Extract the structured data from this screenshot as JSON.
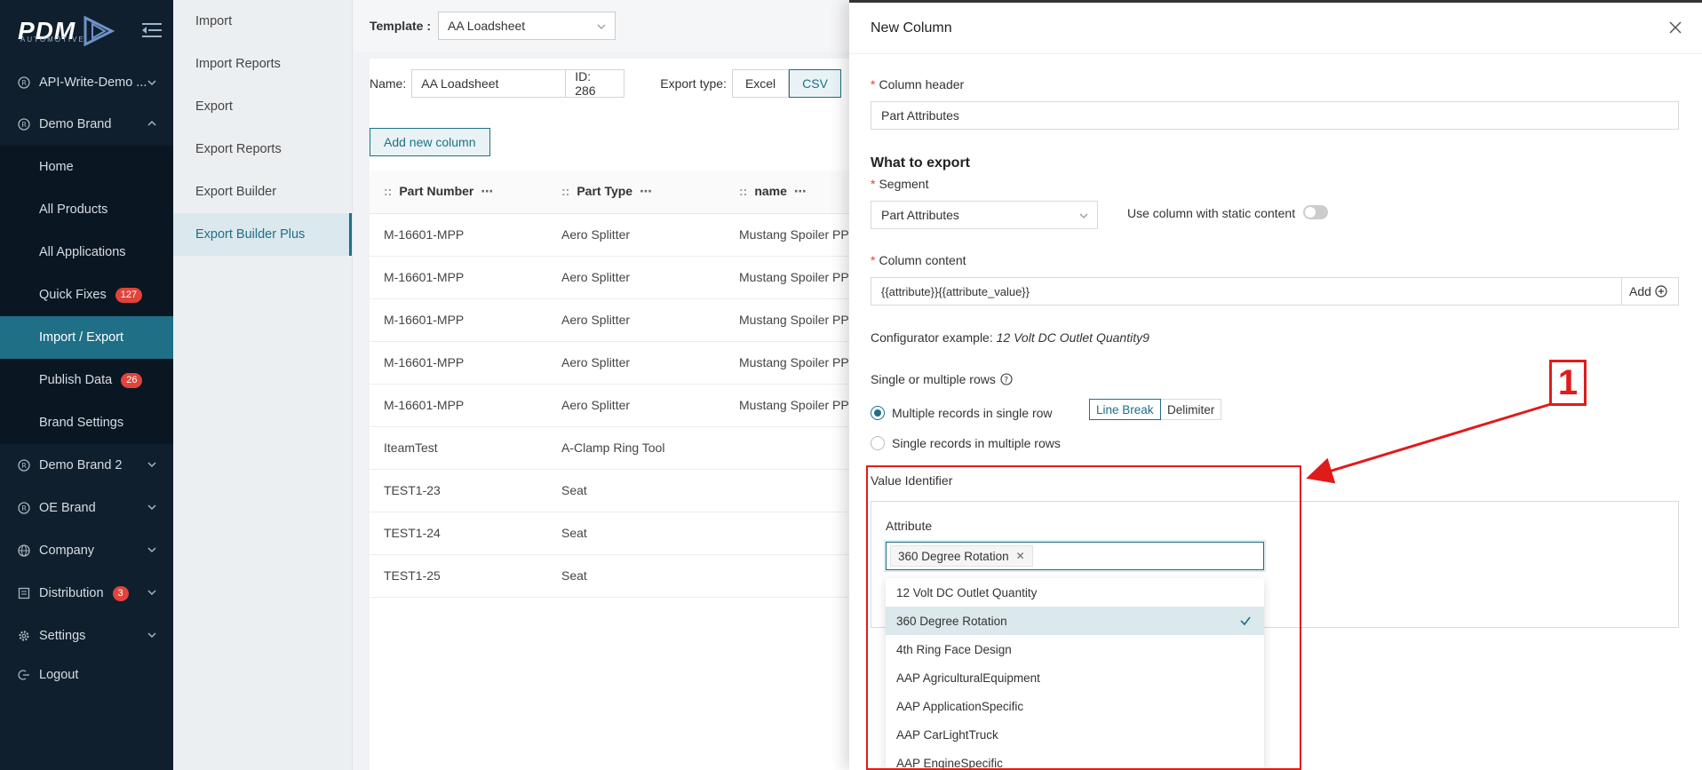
{
  "brand": {
    "logo_text": "PDM",
    "logo_sub": "AUTOMOTIVE"
  },
  "sidebar": {
    "items": [
      {
        "label": "API-Write-Demo ...",
        "icon": "registered-icon"
      },
      {
        "label": "Demo Brand",
        "icon": "registered-icon"
      },
      {
        "label": "Home"
      },
      {
        "label": "All Products"
      },
      {
        "label": "All Applications"
      },
      {
        "label": "Quick Fixes",
        "badge": "127"
      },
      {
        "label": "Import / Export"
      },
      {
        "label": "Publish Data",
        "badge": "26"
      },
      {
        "label": "Brand Settings"
      },
      {
        "label": "Demo Brand 2",
        "icon": "registered-icon"
      },
      {
        "label": "OE Brand",
        "icon": "registered-icon"
      },
      {
        "label": "Company",
        "icon": "globe-icon"
      },
      {
        "label": "Distribution",
        "icon": "distribution-icon",
        "badge": "3"
      },
      {
        "label": "Settings",
        "icon": "gear-icon"
      },
      {
        "label": "Logout",
        "icon": "logout-icon"
      }
    ]
  },
  "submenu": {
    "items": [
      "Import",
      "Import Reports",
      "Export",
      "Export Reports",
      "Export Builder",
      "Export Builder Plus"
    ]
  },
  "main": {
    "template_label": "Template :",
    "template_value": "AA Loadsheet",
    "name_label": "Name:",
    "name_value": "AA Loadsheet",
    "id_value": "ID: 286",
    "export_type_label": "Export type:",
    "export_types": [
      "Excel",
      "CSV"
    ],
    "add_column_label": "Add new column",
    "table": {
      "headers": [
        "Part Number",
        "Part Type",
        "name"
      ],
      "rows": [
        [
          "M-16601-MPP",
          "Aero Splitter",
          "Mustang Spoiler PP"
        ],
        [
          "M-16601-MPP",
          "Aero Splitter",
          "Mustang Spoiler PP"
        ],
        [
          "M-16601-MPP",
          "Aero Splitter",
          "Mustang Spoiler PP"
        ],
        [
          "M-16601-MPP",
          "Aero Splitter",
          "Mustang Spoiler PP"
        ],
        [
          "M-16601-MPP",
          "Aero Splitter",
          "Mustang Spoiler PP"
        ],
        [
          "IteamTest",
          "A-Clamp Ring Tool",
          ""
        ],
        [
          "TEST1-23",
          "Seat",
          ""
        ],
        [
          "TEST1-24",
          "Seat",
          ""
        ],
        [
          "TEST1-25",
          "Seat",
          ""
        ]
      ]
    }
  },
  "drawer": {
    "title": "New Column",
    "column_header_label": "Column header",
    "column_header_value": "Part Attributes",
    "what_to_export": "What to export",
    "segment_label": "Segment",
    "segment_value": "Part Attributes",
    "static_content_label": "Use column with static content",
    "column_content_label": "Column content",
    "column_content_value": "{{attribute}}{{attribute_value}}",
    "add_label": "Add",
    "configurator_label": "Configurator example:",
    "configurator_value": "12 Volt DC Outlet Quantity9",
    "rows_label": "Single or multiple rows",
    "radio_multiple": "Multiple records in single row",
    "radio_single": "Single records in multiple rows",
    "sep_line_break": "Line Break",
    "sep_delimiter": "Delimiter",
    "value_identifier_label": "Value Identifier",
    "attribute_label": "Attribute",
    "selected_tag": "360 Degree Rotation",
    "options": [
      "12 Volt DC Outlet Quantity",
      "360 Degree Rotation",
      "4th Ring Face Design",
      "AAP AgriculturalEquipment",
      "AAP ApplicationSpecific",
      "AAP CarLightTruck",
      "AAP EngineSpecific"
    ],
    "selected_option_index": 1
  },
  "annotation": {
    "number": "1",
    "color": "#e01b1b"
  },
  "colors": {
    "accent": "#1f6f86",
    "sidebar_bg": "#0f1f2d",
    "badge": "#e0443a"
  }
}
